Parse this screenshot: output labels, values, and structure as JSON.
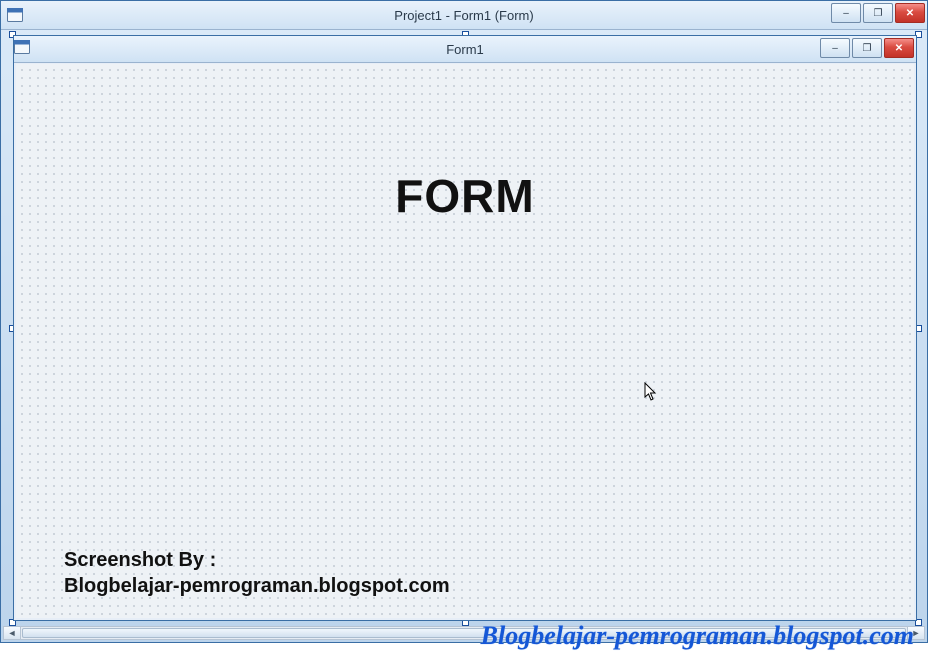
{
  "outer": {
    "title": "Project1 - Form1 (Form)",
    "controls": {
      "min": "–",
      "max": "❐",
      "close": "✕"
    }
  },
  "inner": {
    "title": "Form1",
    "controls": {
      "min": "–",
      "max": "❐",
      "close": "✕"
    },
    "big_label": "FORM",
    "credit1": "Screenshot By :",
    "credit2": "Blogbelajar-pemrograman.blogspot.com"
  },
  "watermark": "Blogbelajar-pemrograman.blogspot.com"
}
